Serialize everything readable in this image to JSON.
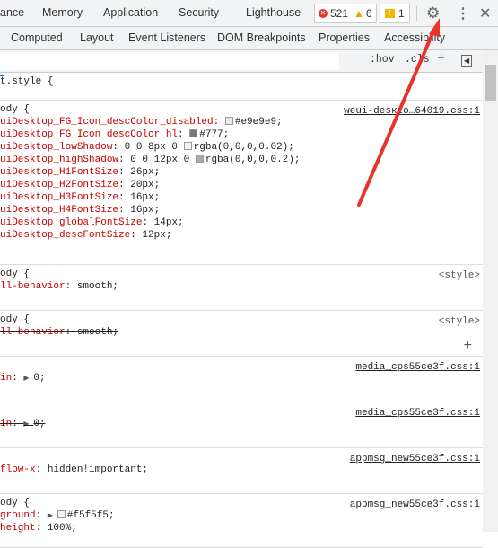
{
  "top_tabs": [
    "ance",
    "Memory",
    "Application",
    "Security",
    "Lighthouse"
  ],
  "badges": {
    "errors": "521",
    "warnings": "6",
    "issues": "1"
  },
  "top_icons": [
    "gear-icon",
    "more-vert-icon",
    "close-icon"
  ],
  "sub_tabs": [
    "Computed",
    "Layout",
    "Event Listeners",
    "DOM Breakpoints",
    "Properties",
    "Accessibility"
  ],
  "filter": {
    "hov": ":hov",
    "cls": ".cls",
    "plus": "+",
    "toggle": "◀"
  },
  "rules": [
    {
      "lines": [
        {
          "text": "t.style {"
        }
      ],
      "source": ""
    },
    {
      "source": "weui-desкto…64019.css:1",
      "lines": [
        {
          "text": "ody {"
        },
        {
          "prop": "uiDesktop_FG_Icon_descColor_disabled",
          "val": "#e9e9e9;",
          "swatch": "#e9e9e9"
        },
        {
          "prop": "uiDesktop_FG_Icon_descColor_hl",
          "val": "#777;",
          "swatch": "#777777"
        },
        {
          "prop": "uiDesktop_lowShadow",
          "pre": "0 0 8px 0 ",
          "val": "rgba(0,0,0,0.02);",
          "swatch": "#f4f4f4"
        },
        {
          "prop": "uiDesktop_highShadow",
          "pre": "0 0 12px 0 ",
          "val": "rgba(0,0,0,0.2);",
          "swatch": "#aaaaaa"
        },
        {
          "prop": "uiDesktop_H1FontSize",
          "val": "26px;"
        },
        {
          "prop": "uiDesktop_H2FontSize",
          "val": "20px;"
        },
        {
          "prop": "uiDesktop_H3FontSize",
          "val": "16px;"
        },
        {
          "prop": "uiDesktop_H4FontSize",
          "val": "16px;"
        },
        {
          "prop": "uiDesktop_globalFontSize",
          "val": "14px;"
        },
        {
          "prop": "uiDesktop_descFontSize",
          "val": "12px;"
        }
      ]
    },
    {
      "source": "<style>",
      "lines": [
        {
          "text": "ody {"
        },
        {
          "prop": "ll-behavior",
          "val": "smooth;"
        }
      ]
    },
    {
      "source": "<style>",
      "strike": true,
      "plus": "+",
      "lines": [
        {
          "text": "ody {"
        },
        {
          "prop": "ll-behavior",
          "val": "smooth;"
        }
      ]
    },
    {
      "source": "media_cps55ce3f.css:1",
      "lines": [
        {
          "text": ""
        },
        {
          "prop": "in",
          "tri": true,
          "val": "0;"
        }
      ]
    },
    {
      "source": "media_cps55ce3f.css:1",
      "strike": true,
      "lines": [
        {
          "text": ""
        },
        {
          "prop": "in",
          "tri": true,
          "val": "0;"
        }
      ]
    },
    {
      "source": "appmsg_new55ce3f.css:1",
      "lines": [
        {
          "text": ""
        },
        {
          "prop": "flow-x",
          "val": "hidden!important;"
        }
      ]
    },
    {
      "source": "appmsg_new55ce3f.css:1",
      "lines": [
        {
          "text": "ody {"
        },
        {
          "prop": "ground",
          "tri": true,
          "val": "#f5f5f5;",
          "swatch": "#f5f5f5"
        },
        {
          "prop": "height",
          "val": "100%;"
        }
      ]
    }
  ],
  "colors": {
    "annotation_arrow": "#e8332a"
  }
}
